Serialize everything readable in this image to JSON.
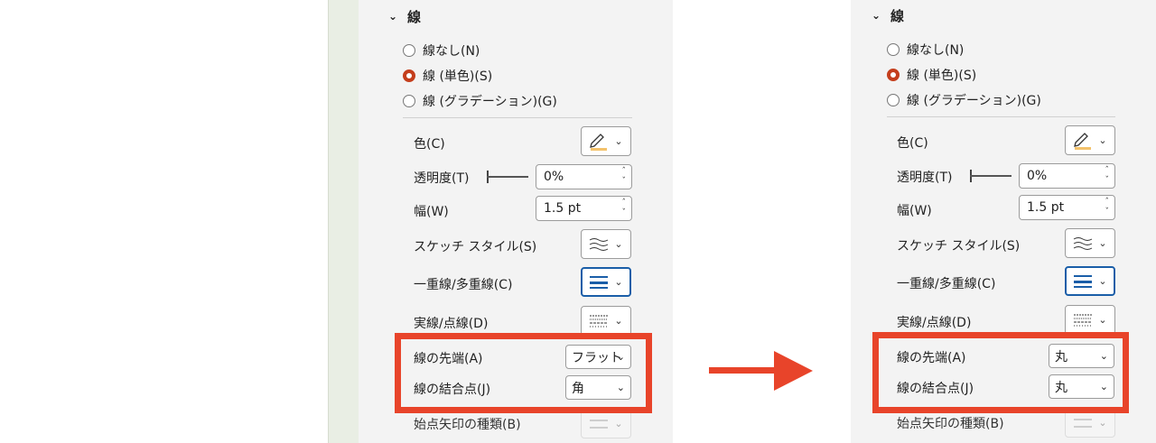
{
  "section": {
    "title": "線"
  },
  "line_type_options": [
    {
      "label": "線なし(N)",
      "checked": false
    },
    {
      "label": "線 (単色)(S)",
      "checked": true
    },
    {
      "label": "線 (グラデーション)(G)",
      "checked": false
    }
  ],
  "properties": {
    "color_label": "色(C)",
    "transparency_label": "透明度(T)",
    "transparency_value": "0%",
    "width_label": "幅(W)",
    "width_value": "1.5 pt",
    "sketch_style_label": "スケッチ スタイル(S)",
    "compound_type_label": "一重線/多重線(C)",
    "dash_type_label": "実線/点線(D)",
    "cap_type_label": "線の先端(A)",
    "join_type_label": "線の結合点(J)",
    "begin_arrow_label": "始点矢印の種類(B)"
  },
  "before": {
    "cap_type_value": "フラット",
    "join_type_value": "角"
  },
  "after": {
    "cap_type_value": "丸",
    "join_type_value": "丸"
  },
  "colors": {
    "highlight": "#e8442a",
    "radio_checked": "#c43e1c",
    "arrow": "#e8442a",
    "accent_blue": "#1a5ea8"
  },
  "icons": {
    "expander": "chevron-down-icon",
    "arrow": "right-arrow-icon"
  }
}
